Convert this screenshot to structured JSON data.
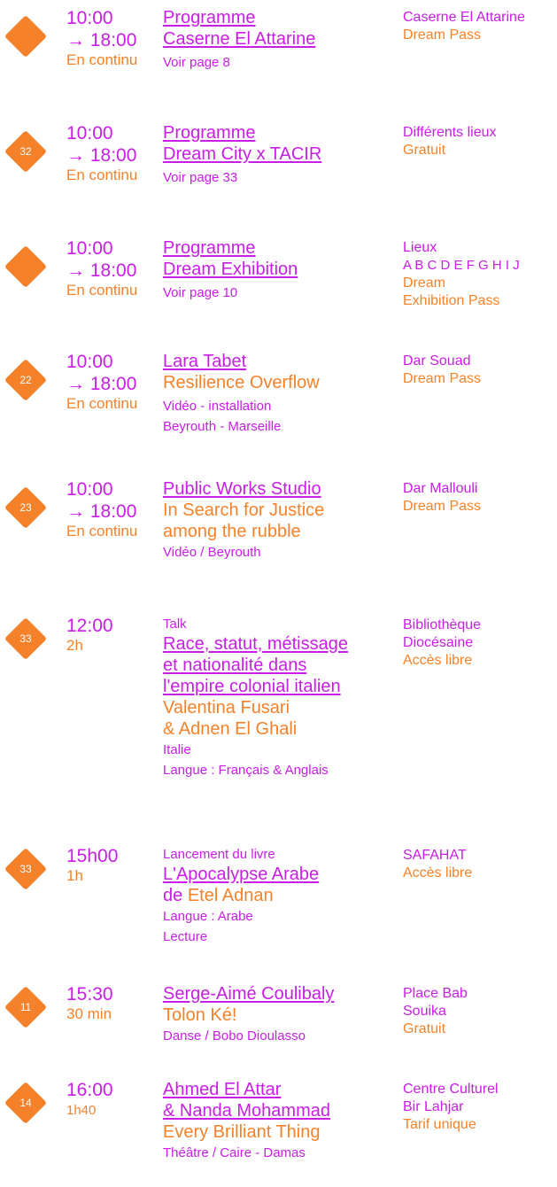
{
  "colors": {
    "accent_magenta": "#C81EE6",
    "accent_orange": "#F5822A"
  },
  "events": [
    {
      "time": "10:00",
      "end": "→ 18:00",
      "duration": "En continu",
      "marker": "",
      "title_lines": [
        "Programme",
        "Caserne El Attarine"
      ],
      "details": [
        "Voir page 8"
      ],
      "venue_lines": [
        "Caserne El Attarine"
      ],
      "price": "Dream Pass"
    },
    {
      "time": "10:00",
      "end": "→ 18:00",
      "duration": "En continu",
      "marker": "32",
      "title_lines": [
        "Programme",
        "Dream City x TACIR"
      ],
      "details": [
        "Voir page 33"
      ],
      "venue_lines": [
        "Différents lieux"
      ],
      "price": "Gratuit"
    },
    {
      "time": "10:00",
      "end": "→ 18:00",
      "duration": "En continu",
      "marker": "",
      "title_lines": [
        "Programme",
        "Dream Exhibition"
      ],
      "details": [
        "Voir page 10"
      ],
      "venue_lines": [
        "Lieux",
        "A B C D E F G H I J"
      ],
      "price_lines": [
        "Dream",
        "Exhibition Pass"
      ]
    },
    {
      "time": "10:00",
      "end": "→ 18:00",
      "duration": "En continu",
      "marker": "22",
      "title_lines": [
        "Lara Tabet"
      ],
      "subtitle_lines": [
        "Resilience Overflow"
      ],
      "details": [
        "Vidéo - installation",
        "Beyrouth - Marseille"
      ],
      "venue_lines": [
        "Dar Souad"
      ],
      "price": "Dream Pass"
    },
    {
      "time": "10:00",
      "end": "→ 18:00",
      "duration": "En continu",
      "marker": "23",
      "title_lines": [
        "Public Works Studio"
      ],
      "subtitle_lines": [
        "In Search for Justice",
        "among the rubble"
      ],
      "details": [
        "Vidéo / Beyrouth"
      ],
      "venue_lines": [
        "Dar Mallouli"
      ],
      "price": "Dream Pass"
    },
    {
      "time": "12:00",
      "duration": "2h",
      "marker": "33",
      "kicker": "Talk",
      "title_lines": [
        "Race, statut, métissage ",
        "et nationalité dans",
        "l'empire colonial italien"
      ],
      "subtitle_lines": [
        "Valentina Fusari",
        "& Adnen El Ghali"
      ],
      "details": [
        "Italie",
        "Langue : Français & Anglais"
      ],
      "venue_lines": [
        "Bibliothèque",
        "Diocésaine"
      ],
      "price": "Accès libre"
    },
    {
      "time": "15h00",
      "duration": "1h",
      "marker": "33",
      "kicker": "Lancement du livre",
      "title_lines": [
        "L'Apocalypse Arabe"
      ],
      "byline": {
        "connector": "de",
        "author": "Etel Adnan"
      },
      "details": [
        "Langue : Arabe",
        "Lecture"
      ],
      "venue_lines": [
        "SAFAHAT"
      ],
      "price": "Accès libre"
    },
    {
      "time": "15:30",
      "duration": "30 min",
      "marker": "11",
      "title_lines": [
        "Serge-Aimé Coulibaly "
      ],
      "subtitle_lines": [
        "Tolon Ké!"
      ],
      "details": [
        "Danse / Bobo Dioulasso"
      ],
      "venue_lines": [
        "Place Bab",
        "Souika"
      ],
      "price": "Gratuit"
    },
    {
      "time": "16:00",
      "duration": "1h40",
      "marker": "14",
      "title_lines": [
        "Ahmed El Attar",
        "& Nanda Mohammad"
      ],
      "subtitle_lines": [
        "Every Brilliant Thing"
      ],
      "details": [
        "Théâtre / Caire - Damas"
      ],
      "venue_lines": [
        "Centre Culturel",
        "Bir Lahjar"
      ],
      "price": "Tarif unique"
    }
  ]
}
